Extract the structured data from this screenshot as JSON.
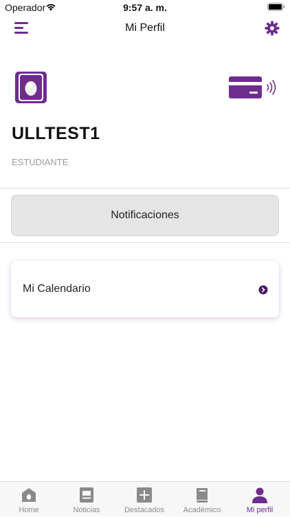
{
  "status_bar": {
    "carrier": "Operador",
    "time": "9:57 a. m.",
    "icons": [
      "wifi-icon",
      "battery-icon"
    ]
  },
  "header": {
    "title": "Mi Perfil",
    "icons": [
      "menu-icon",
      "gear-icon"
    ]
  },
  "profile": {
    "name": "ULLTEST1",
    "role": "ESTUDIANTE",
    "icons": [
      "avatar-egg-icon",
      "card-icon",
      "nfc-icon"
    ]
  },
  "notifications": {
    "label": "Notificaciones"
  },
  "calendar": {
    "label": "Mi Calendario",
    "icon": "chevron-right-icon"
  },
  "tabs": [
    {
      "label": "Home",
      "icon": "home-icon",
      "active": false
    },
    {
      "label": "Noticias",
      "icon": "news-icon",
      "active": false
    },
    {
      "label": "Destacados",
      "icon": "plus-icon",
      "active": false
    },
    {
      "label": "Académico",
      "icon": "book-icon",
      "active": false
    },
    {
      "label": "Mi perfil",
      "icon": "person-icon",
      "active": true
    }
  ],
  "colors": {
    "accent": "#6e2c8e",
    "inactive_tab": "#8a8a8a",
    "button_bg": "#e5e5e5"
  }
}
